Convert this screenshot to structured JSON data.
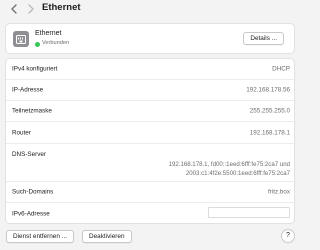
{
  "toolbar": {
    "title": "Ethernet",
    "back_icon": "chevron-left-icon",
    "forward_icon": "chevron-right-icon"
  },
  "service": {
    "name": "Ethernet",
    "status": "Verbunden",
    "status_color": "#34c759",
    "icon": "ethernet-port-icon",
    "details_label": "Details ..."
  },
  "details": {
    "rows": [
      {
        "label": "IPv4 konfiguriert",
        "value": "DHCP"
      },
      {
        "label": "IP-Adresse",
        "value": "192.168.178.56"
      },
      {
        "label": "Teilnetzmaske",
        "value": "255.255.255.0"
      },
      {
        "label": "Router",
        "value": "192.168.178.1"
      }
    ],
    "dns": {
      "label": "DNS-Server",
      "line1": "192.168.178.1, fd00::1eed:6fff:fe75:2ca7 und",
      "line2": "2003:c1:4f2e:5500:1eed:6fff:fe75:2ca7"
    },
    "search_domains": {
      "label": "Such-Domains",
      "value": "fritz.box"
    },
    "ipv6": {
      "label": "IPv6-Adresse",
      "value": ""
    }
  },
  "footer": {
    "remove_label": "Dienst entfernen ...",
    "deactivate_label": "Deaktivieren",
    "help_label": "?"
  }
}
